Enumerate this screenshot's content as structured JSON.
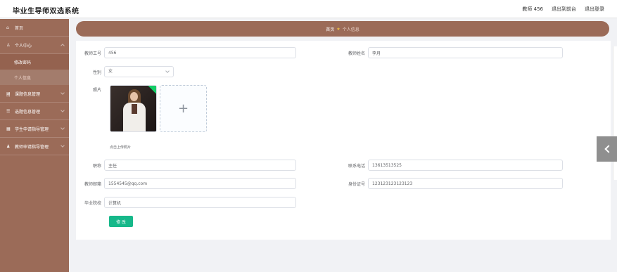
{
  "app": {
    "title": "毕业生导师双选系统"
  },
  "header": {
    "user_label": "教师 456",
    "front_link": "退出到前台",
    "logout_link": "退出登录"
  },
  "sidebar": {
    "items": [
      {
        "label": "首页",
        "icon": "home-icon"
      },
      {
        "label": "个人中心",
        "icon": "user-icon"
      },
      {
        "label": "课题信息管理",
        "icon": "document-icon"
      },
      {
        "label": "选题信息管理",
        "icon": "list-icon"
      },
      {
        "label": "学生申请指导管理",
        "icon": "form-icon"
      },
      {
        "label": "教师申请指导管理",
        "icon": "people-icon"
      }
    ],
    "sub_items": [
      {
        "label": "修改密码"
      },
      {
        "label": "个人信息"
      }
    ]
  },
  "breadcrumb": {
    "home": "首页",
    "current": "个人信息"
  },
  "form": {
    "teacher_id_label": "教师工号",
    "teacher_id_value": "456",
    "teacher_name_label": "教师姓名",
    "teacher_name_value": "李月",
    "gender_label": "性别",
    "gender_value": "女",
    "photo_label": "照片",
    "upload_hint": "点击上传照片",
    "title_label": "职称",
    "title_value": "主任",
    "phone_label": "联系电话",
    "phone_value": "13613513525",
    "email_label": "教师邮箱",
    "email_value": "1554545@qq.com",
    "idcard_label": "身份证号",
    "idcard_value": "123123123123123",
    "school_label": "毕业院校",
    "school_value": "计算机",
    "submit_label": "修 改"
  },
  "colors": {
    "sidebar_bg": "#9b6b58",
    "accent_button": "#16b88a"
  }
}
